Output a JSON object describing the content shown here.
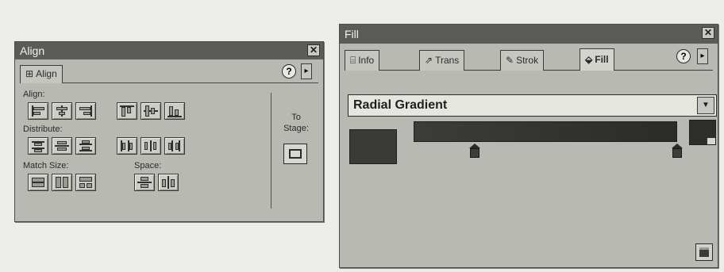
{
  "align_panel": {
    "title": "Align",
    "close_label": "✕",
    "tab_label": "Align",
    "help_label": "?",
    "arrow_label": "▸",
    "sections": {
      "align": "Align:",
      "distribute": "Distribute:",
      "match_size": "Match Size:",
      "space": "Space:",
      "to_stage": "To Stage:"
    }
  },
  "fill_panel": {
    "title": "Fill",
    "close_label": "✕",
    "tabs": [
      {
        "label": "Info"
      },
      {
        "label": "Trans"
      },
      {
        "label": "Strok"
      },
      {
        "label": "Fill"
      }
    ],
    "help_label": "?",
    "arrow_label": "▸",
    "dropdown_value": "Radial Gradient",
    "dropdown_arrow": "▼"
  },
  "icons": {
    "align_left": "align-left-edge-icon",
    "align_hcenter": "align-horizontal-center-icon",
    "align_right": "align-right-edge-icon",
    "align_top": "align-top-edge-icon",
    "align_vcenter": "align-vertical-center-icon",
    "align_bottom": "align-bottom-edge-icon",
    "to_stage": "to-stage-icon",
    "save": "save-icon"
  }
}
